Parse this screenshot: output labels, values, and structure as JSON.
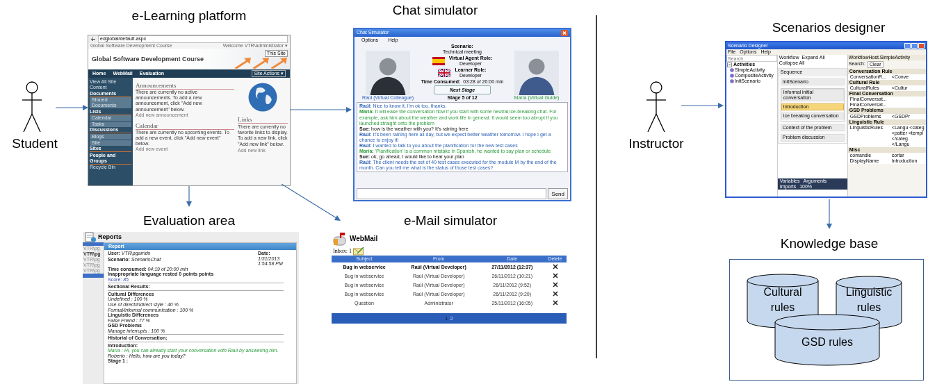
{
  "actors": [
    {
      "label": "Student"
    },
    {
      "label": "Instructor"
    }
  ],
  "elearning": {
    "title": "e-Learning platform",
    "url": "edglobal/default.aspx",
    "site_name": "Global Software Development Course",
    "welcome": "Welcome VTR\\administrator ▾",
    "search_placeholder": "This Site",
    "site_title": "Global Software Development Course",
    "nav": [
      "Home",
      "WebMail",
      "Evaluation"
    ],
    "site_actions": "Site Actions ▾",
    "sidebar": [
      {
        "label": "View All Site Content",
        "kind": "link"
      },
      {
        "label": "Documents",
        "kind": "heading"
      },
      {
        "label": "Shared Documents",
        "kind": "item"
      },
      {
        "label": "Lists",
        "kind": "heading"
      },
      {
        "label": "Calendar",
        "kind": "item"
      },
      {
        "label": "Tasks",
        "kind": "item"
      },
      {
        "label": "Discussions",
        "kind": "heading"
      },
      {
        "label": "Blogs",
        "kind": "item"
      },
      {
        "label": "Site",
        "kind": "item"
      },
      {
        "label": "Sites",
        "kind": "heading"
      },
      {
        "label": "People and Groups",
        "kind": "heading"
      },
      {
        "label": "Recycle Bin",
        "kind": "link"
      }
    ],
    "sections": [
      {
        "title": "Announcements",
        "text": "There are currently no active announcements. To add a new announcement, click \"Add new announcement\" below.",
        "link": "Add new announcement"
      },
      {
        "title": "Calendar",
        "text": "There are currently no upcoming events. To add a new event, click \"Add new event\" below.",
        "link": "Add new event"
      }
    ],
    "links": {
      "title": "Links",
      "text": "There are currently no favorite links to display. To add a new link, click \"Add new link\" below.",
      "link": "Add new link"
    }
  },
  "chat": {
    "title": "Chat simulator",
    "window_title": "Chat Simulator",
    "menu": [
      "Options",
      "Help"
    ],
    "info": [
      {
        "label": "Scenario:",
        "value": "Technical meeting",
        "kind": "plain"
      },
      {
        "label": "Virtual Agent Role:",
        "value": "Developer",
        "kind": "spain"
      },
      {
        "label": "Learner Role:",
        "value": "Developer",
        "kind": "uk"
      }
    ],
    "time_label": "Time Consumed:",
    "time_value": "03:28 of 20:00 min",
    "next_button": "Next Stage",
    "stage": "Stage 5 of 12",
    "left_agent": "Raúl (Virtual Colleague)",
    "right_agent": "María (Virtual Guide)",
    "messages": [
      {
        "speaker": "Raúl:",
        "kind": "agent",
        "text": "Nice to know it, I'm ok too, thanks."
      },
      {
        "speaker": "María:",
        "kind": "guide",
        "text": "It will ease the conversation flow if you start with some neutral ice-breaking chat. For example, ask him about the weather and work life in general. It would seem too abrupt if you launched straight onto the problem"
      },
      {
        "speaker": "Sue:",
        "kind": "user",
        "text": "how is the weather with you? It's raining here"
      },
      {
        "speaker": "Raúl:",
        "kind": "agent",
        "text": "It's been raining here all day, but we expect better weather tomorrow. I hope I get a chance to enjoy it!"
      },
      {
        "speaker": "Raúl:",
        "kind": "agent",
        "text": "I wanted to talk to you about the planification for the new test cases"
      },
      {
        "speaker": "María:",
        "kind": "guide",
        "text": "'Planification' is a common mistake in Spanish, he wanted to say plan or schedule"
      },
      {
        "speaker": "Sue:",
        "kind": "user",
        "text": "ok, go ahead, I would like to hear your plan"
      },
      {
        "speaker": "Raúl:",
        "kind": "agent",
        "text": "The client needs the set of 40 test cases executed for the module M by the end of the month. Can you tell me what is the status of those test cases?"
      }
    ],
    "send_button": "Send"
  },
  "evaluation": {
    "title": "Evaluation area",
    "page_title": "Reports",
    "list": [
      {
        "label": "VTR\\pg",
        "selected": false
      },
      {
        "label": "VTR\\pg",
        "selected": true
      },
      {
        "label": "VTR\\pg",
        "selected": false
      },
      {
        "label": "VTR\\pg",
        "selected": false
      },
      {
        "label": "VTR\\pg",
        "selected": false
      }
    ],
    "report_title": "Report",
    "user_label": "User:",
    "user": "VTR\\pgarrido",
    "scenario_label": "Scenario:",
    "scenario": "ScenarioChat",
    "date_label": "Date:",
    "date": "1/31/2013",
    "time": "1:54:58 PM",
    "time_label": "Time consumed:",
    "time_value": "04:19 of 20:00 min",
    "penalty": "Inappropriate language rested 0 points points",
    "score_label": "Score:",
    "score": "85",
    "sectional": "Sectional Results:",
    "groups": [
      {
        "name": "Cultural Differences",
        "items": [
          "Undefined : 100 %",
          "Use of direct/indirect style : 40 %",
          "Formal/informal communication : 100 %"
        ]
      },
      {
        "name": "Linguistic Differences",
        "items": [
          "False Friend : 77 %"
        ]
      },
      {
        "name": "GSD Problems",
        "items": [
          "Manage interrupts : 100 %"
        ]
      }
    ],
    "history": "Historial of Conversation:",
    "stage_intro": "Introduction:",
    "conversation": [
      {
        "kind": "guide",
        "text": "María : Hi, you can already start your conversation with Raúl by answering him."
      },
      {
        "kind": "user",
        "text": "Roberto : Hello, how are you today?"
      }
    ],
    "stage_next": "Stage 1 :"
  },
  "webmail": {
    "title": "e-Mail simulator",
    "app_name": "WebMail",
    "inbox": "Inbox: 1",
    "columns": [
      "Subject",
      "From",
      "Date",
      "Delete"
    ],
    "rows": [
      {
        "subject": "Bug in webservice",
        "from": "Raúl (Virtual Developer)",
        "date": "27/11/2012 (12:37)",
        "unread": true
      },
      {
        "subject": "Bug in webservice",
        "from": "Raúl (Virtual Developer)",
        "date": "26/11/2012 (10:21)",
        "unread": false
      },
      {
        "subject": "Bug in webservice",
        "from": "Raúl (Virtual Developer)",
        "date": "26/11/2012 (9:52)",
        "unread": false
      },
      {
        "subject": "Bug in webservice",
        "from": "Raúl (Virtual Developer)",
        "date": "26/11/2012 (9:20)",
        "unread": false
      },
      {
        "subject": "Question",
        "from": "Administrator",
        "date": "25/11/2012 (16:05)",
        "unread": false
      }
    ],
    "pages": [
      {
        "label": "1",
        "selected": true
      },
      {
        "label": "2",
        "selected": false
      }
    ]
  },
  "designer": {
    "title": "Scenarios designer",
    "window_title": "Scenario Designer",
    "menu": [
      "File",
      "Options",
      "Help"
    ],
    "search_placeholder": "Search",
    "tree": {
      "label": "Activities",
      "children": [
        {
          "label": "SimpleActivity"
        },
        {
          "label": "CompositeActivity"
        },
        {
          "label": "InitScenario"
        }
      ]
    },
    "workflow_label": "Workflow",
    "expand_all": "Expand All",
    "collapse_all": "Collapse All",
    "sequence": "Sequence",
    "nodes": [
      {
        "label": "InitScenario",
        "selected": false
      },
      {
        "label": "Informal initial conversation",
        "selected": false,
        "children": [
          {
            "label": "Introduction",
            "selected": true
          },
          {
            "label": "Ice breaking conversation",
            "selected": false
          }
        ]
      },
      {
        "label": "Context of the problem",
        "selected": false
      },
      {
        "label": "Problem discussion",
        "selected": false
      }
    ],
    "props_title": "WorkflowHost.SimpleActivity",
    "props_search": "Search:",
    "props_clear": "Clear",
    "categories": [
      {
        "name": "Conversation Rule",
        "props": [
          {
            "name": "ConversationR...",
            "value": "<Conve"
          }
        ]
      },
      {
        "name": "Cultural Rule",
        "props": [
          {
            "name": "CulturalRules",
            "value": "<Cultur"
          }
        ]
      },
      {
        "name": "Final Conversation",
        "props": [
          {
            "name": "FinalConversat..."
          },
          {
            "name": "FinalConversat..."
          }
        ]
      },
      {
        "name": "GSD Problems",
        "props": [
          {
            "name": "GSDProblems",
            "value": "<GSDPr"
          }
        ]
      },
      {
        "name": "Linguistic Rule",
        "props": [
          {
            "name": "LinguisticRules",
            "value": "<Langu <categ <patter <templ </categ </Langu"
          }
        ]
      },
      {
        "name": "Misc",
        "props": [
          {
            "name": "comandle",
            "value": "cortar"
          },
          {
            "name": "DisplayName",
            "value": "Introduction"
          }
        ]
      }
    ],
    "bottom_tabs": [
      "Variables",
      "Arguments",
      "Imports"
    ],
    "zoom": "100%"
  },
  "knowledge": {
    "title": "Knowledge base",
    "stores": [
      {
        "label": "Cultural rules"
      },
      {
        "label": "Linguistic rules"
      },
      {
        "label": "GSD rules"
      }
    ]
  }
}
